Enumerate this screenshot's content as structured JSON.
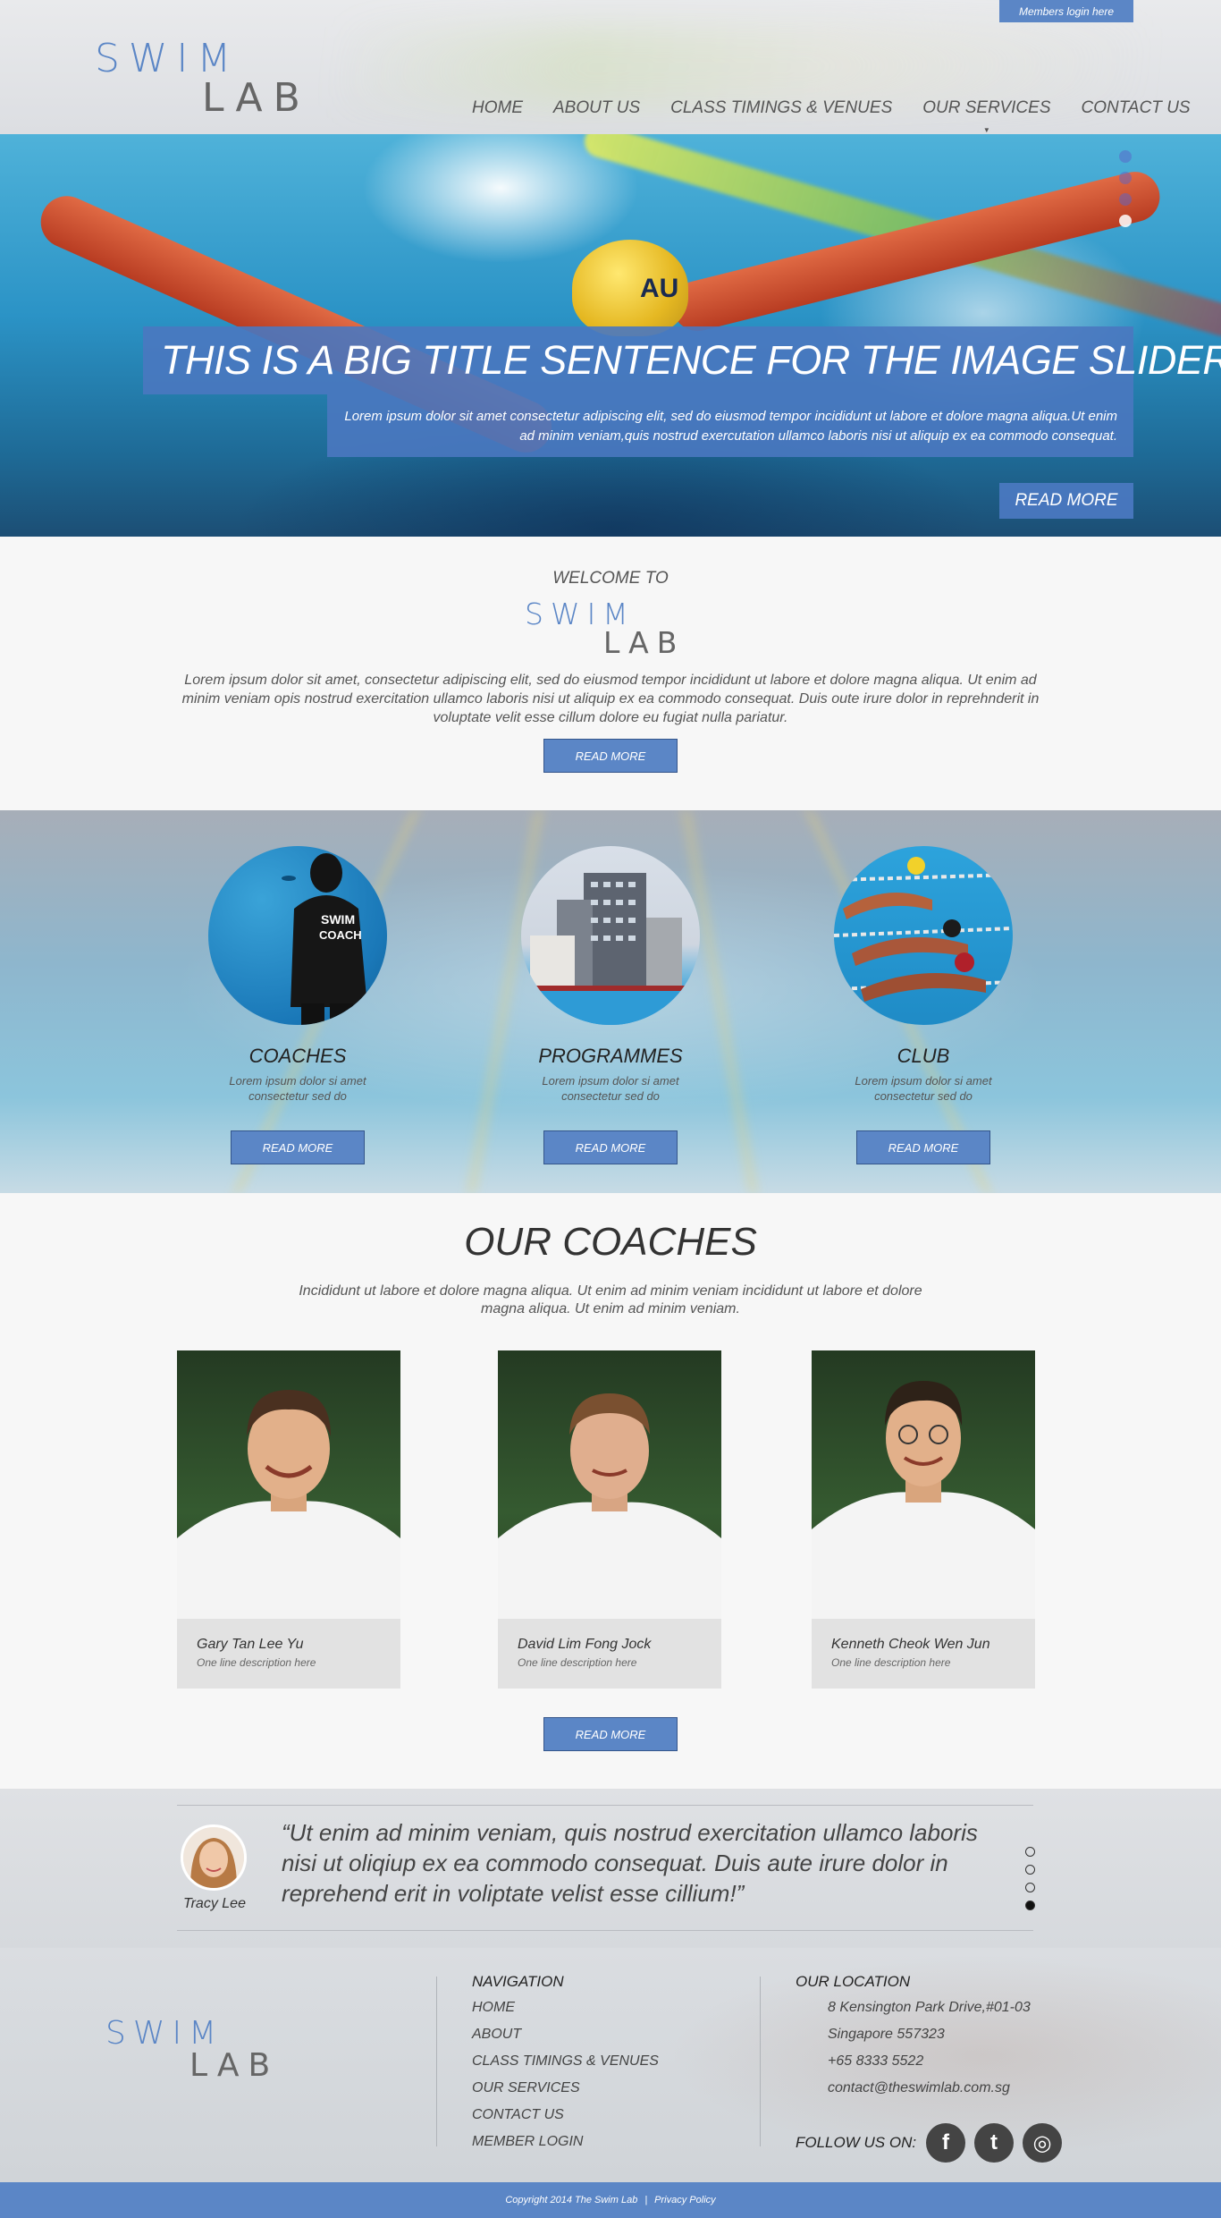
{
  "header": {
    "members_login": "Members login here",
    "logo_top": "SWIM",
    "logo_bottom": "LAB",
    "nav": [
      "HOME",
      "ABOUT US",
      "CLASS TIMINGS & VENUES",
      "OUR SERVICES",
      "CONTACT US"
    ],
    "active_nav_index": 3
  },
  "hero": {
    "title": "THIS IS A BIG TITLE SENTENCE FOR THE IMAGE SLIDER",
    "description": "Lorem ipsum dolor sit amet consectetur adipiscing elit, sed do eiusmod tempor incididunt ut labore et dolore magna aliqua.Ut enim ad minim veniam,quis nostrud exercutation ullamco laboris nisi ut aliquip ex ea commodo consequat.",
    "read_more": "READ MORE",
    "cap_text": "AU",
    "slide_count": 4,
    "active_slide": 4
  },
  "welcome": {
    "pre_title": "WELCOME TO",
    "logo_top": "SWIM",
    "logo_bottom": "LAB",
    "text": "Lorem ipsum dolor sit amet, consectetur adipiscing elit, sed do eiusmod tempor incididunt ut labore et dolore magna aliqua. Ut enim ad minim veniam opis nostrud exercitation ullamco laboris nisi ut aliquip ex ea commodo consequat. Duis oute irure dolor in reprehnderit in voluptate velit esse cillum dolore eu fugiat nulla pariatur.",
    "read_more": "READ MORE"
  },
  "features": [
    {
      "title": "COACHES",
      "desc": "Lorem ipsum dolor si amet consectetur sed do",
      "read_more": "READ MORE",
      "jacket_text_1": "SWIM",
      "jacket_text_2": "COACH"
    },
    {
      "title": "PROGRAMMES",
      "desc": "Lorem ipsum dolor si amet consectetur sed do",
      "read_more": "READ MORE"
    },
    {
      "title": "CLUB",
      "desc": "Lorem ipsum dolor si amet consectetur sed do",
      "read_more": "READ MORE"
    }
  ],
  "coaches": {
    "title": "OUR COACHES",
    "text": "Incididunt ut labore et dolore magna aliqua. Ut enim ad minim veniam incididunt ut labore et dolore magna aliqua. Ut enim ad minim veniam.",
    "list": [
      {
        "name": "Gary Tan Lee Yu",
        "role": "One line description here"
      },
      {
        "name": "David Lim Fong Jock",
        "role": "One line description here"
      },
      {
        "name": "Kenneth Cheok Wen Jun",
        "role": "One line description here"
      }
    ],
    "read_more": "READ MORE"
  },
  "testimonial": {
    "quote": "“Ut enim ad minim veniam, quis nostrud exercitation ullamco laboris nisi ut oliqiup ex ea commodo consequat. Duis aute irure dolor in reprehend erit in voliptate velist esse cillium!”",
    "author": "Tracy Lee",
    "dot_count": 4,
    "active_dot": 4
  },
  "footer": {
    "logo_top": "SWIM",
    "logo_bottom": "LAB",
    "nav_heading": "NAVIGATION",
    "nav_links": [
      "HOME",
      "ABOUT",
      "CLASS TIMINGS & VENUES",
      "OUR SERVICES",
      "CONTACT US",
      "MEMBER LOGIN"
    ],
    "location_heading": "OUR LOCATION",
    "address_line1": "8 Kensington Park Drive,#01-03",
    "address_line2": "Singapore 557323",
    "phone": "+65 8333 5522",
    "email": "contact@theswimlab.com.sg",
    "follow_label": "FOLLOW US ON:",
    "social": [
      {
        "icon": "facebook-icon",
        "glyph": "f"
      },
      {
        "icon": "twitter-icon",
        "glyph": "t"
      },
      {
        "icon": "instagram-icon",
        "glyph": "◎"
      }
    ]
  },
  "copyright": {
    "text": "Copyright 2014 The Swim Lab",
    "separator": "|",
    "privacy": "Privacy Policy"
  },
  "colors": {
    "brand_blue": "#5b86c6",
    "text_dark": "#333333"
  }
}
